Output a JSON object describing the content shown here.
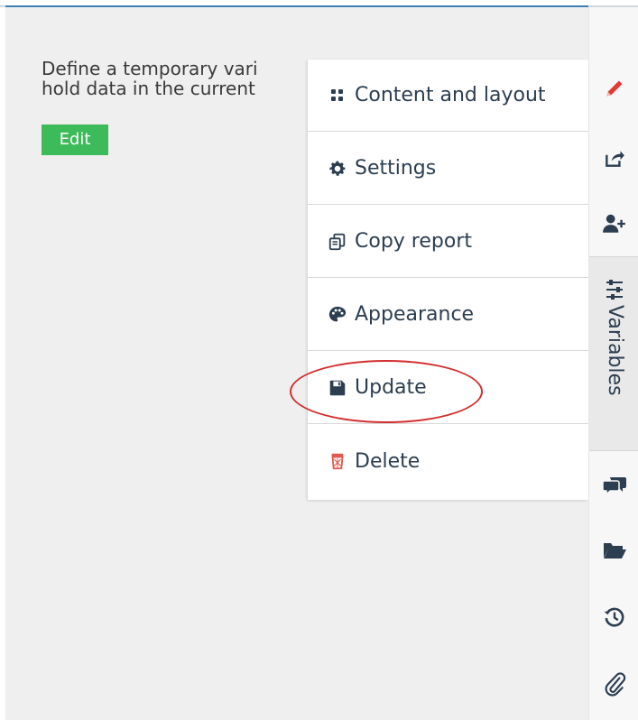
{
  "panel": {
    "description": "Define a temporary vari\nhold data in the current",
    "edit_label": "Edit"
  },
  "menu": {
    "items": [
      {
        "label": "Content and layout",
        "icon": "grid-icon"
      },
      {
        "label": "Settings",
        "icon": "gear-icon"
      },
      {
        "label": "Copy report",
        "icon": "copy-icon"
      },
      {
        "label": "Appearance",
        "icon": "palette-icon"
      },
      {
        "label": "Update",
        "icon": "save-icon"
      },
      {
        "label": "Delete",
        "icon": "trash-icon"
      }
    ]
  },
  "sidebar": {
    "variables_label": "Variables",
    "icons": [
      "pencil-icon",
      "share-icon",
      "add-user-icon",
      "sliders-icon",
      "comments-icon",
      "folder-open-icon",
      "history-icon",
      "paperclip-icon"
    ]
  },
  "colors": {
    "edit_button": "#3dbb5a",
    "accent": "#3f7fb4",
    "annotation": "#d32f2f",
    "delete_icon": "#e05a4f",
    "pencil_icon": "#e53935",
    "icon_dark": "#2c3e50"
  }
}
